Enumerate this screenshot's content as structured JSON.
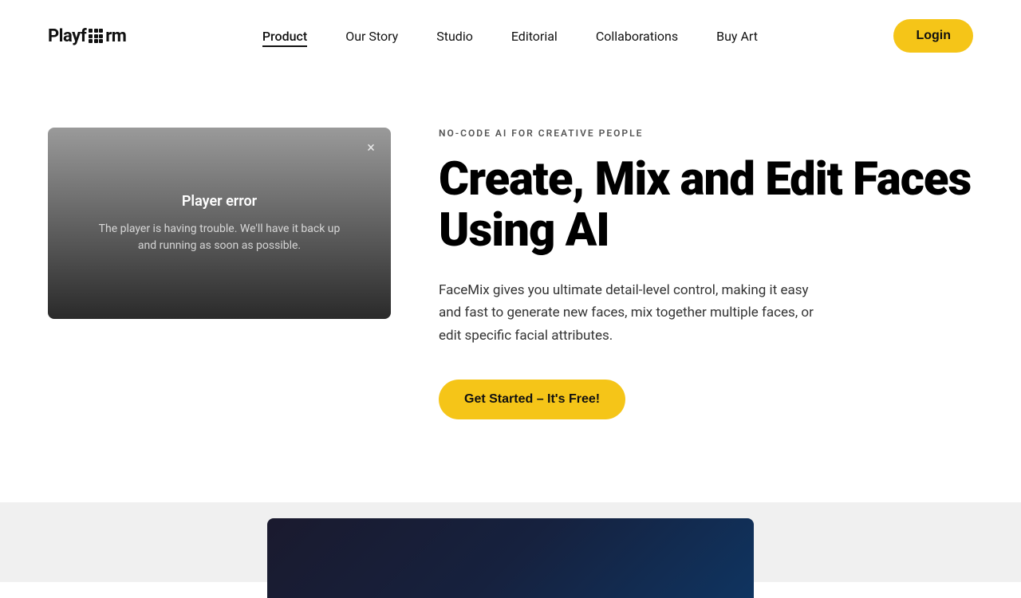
{
  "logo": {
    "text_before": "Playf",
    "text_after": "rm"
  },
  "nav": {
    "items": [
      {
        "label": "Product",
        "active": true
      },
      {
        "label": "Our Story",
        "active": false
      },
      {
        "label": "Studio",
        "active": false
      },
      {
        "label": "Editorial",
        "active": false
      },
      {
        "label": "Collaborations",
        "active": false
      },
      {
        "label": "Buy Art",
        "active": false
      }
    ],
    "login_label": "Login"
  },
  "video_player": {
    "error_title": "Player error",
    "error_message": "The player is having trouble. We'll have it back up and running as soon as possible.",
    "close_icon": "×"
  },
  "hero": {
    "tag": "NO-CODE AI FOR CREATIVE PEOPLE",
    "title": "Create, Mix and Edit Faces Using AI",
    "description": "FaceMix gives you ultimate detail-level control, making it easy and fast to generate new faces, mix together multiple faces, or edit specific facial attributes.",
    "cta_label": "Get Started – It's Free!"
  }
}
